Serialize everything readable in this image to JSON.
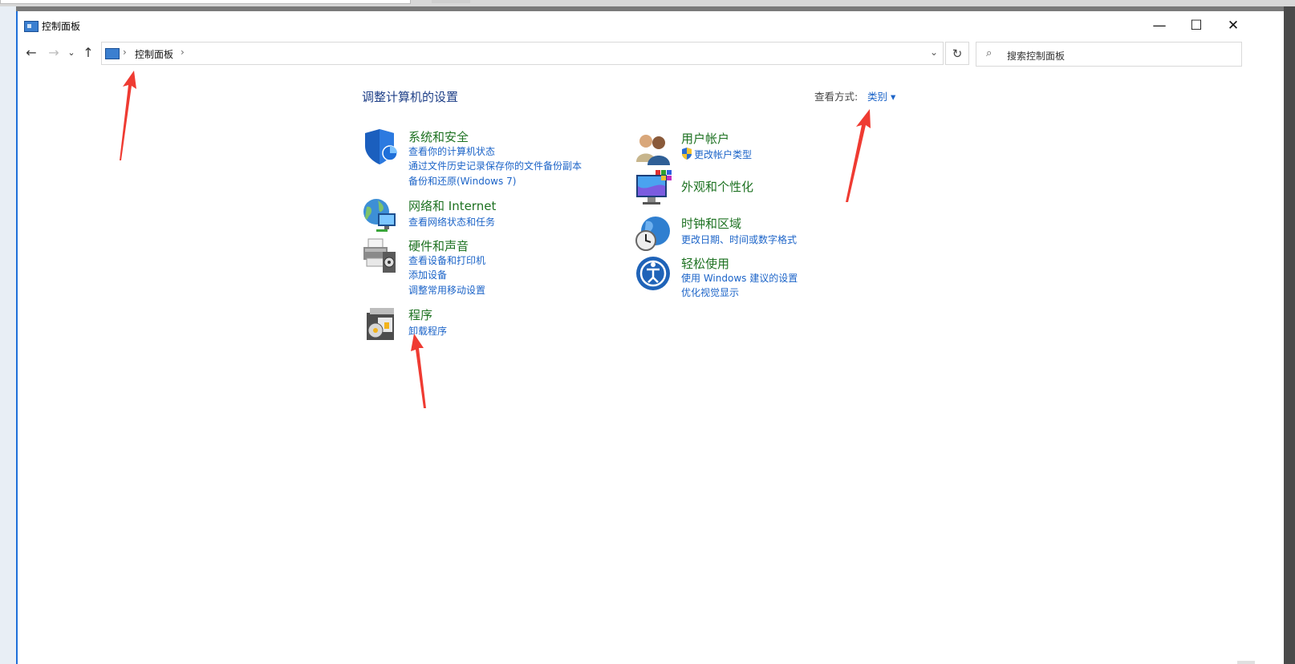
{
  "window": {
    "title": "控制面板",
    "minimize_glyph": "—",
    "maximize_glyph": "☐",
    "close_glyph": "✕"
  },
  "nav": {
    "back_glyph": "←",
    "forward_glyph": "→",
    "recent_glyph": "⌄",
    "up_glyph": "↑",
    "breadcrumb": "控制面板",
    "breadcrumb_sep": "›",
    "dropdown_glyph": "⌄",
    "refresh_glyph": "↻",
    "search_placeholder": "搜索控制面板"
  },
  "main": {
    "title": "调整计算机的设置",
    "view_by_label": "查看方式:",
    "view_by_value": "类别 ▾"
  },
  "categories": {
    "system": {
      "title": "系统和安全",
      "links": [
        "查看你的计算机状态",
        "通过文件历史记录保存你的文件备份副本",
        "备份和还原(Windows 7)"
      ]
    },
    "network": {
      "title": "网络和 Internet",
      "links": [
        "查看网络状态和任务"
      ]
    },
    "hardware": {
      "title": "硬件和声音",
      "links": [
        "查看设备和打印机",
        "添加设备",
        "调整常用移动设置"
      ]
    },
    "programs": {
      "title": "程序",
      "links": [
        "卸载程序"
      ]
    },
    "accounts": {
      "title": "用户帐户",
      "links": [
        "更改帐户类型"
      ]
    },
    "appearance": {
      "title": "外观和个性化",
      "links": []
    },
    "clock": {
      "title": "时钟和区域",
      "links": [
        "更改日期、时间或数字格式"
      ]
    },
    "ease": {
      "title": "轻松使用",
      "links": [
        "使用 Windows 建议的设置",
        "优化视觉显示"
      ]
    }
  },
  "colors": {
    "category_title": "#1e7222",
    "link": "#1c64c8",
    "heading": "#1e3f87",
    "annotation_arrow": "#ef3b32"
  }
}
